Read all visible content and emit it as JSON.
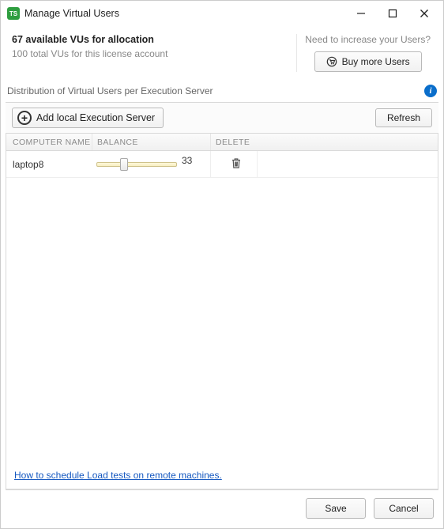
{
  "window": {
    "title": "Manage Virtual Users"
  },
  "summary": {
    "available_line": "67 available VUs for allocation",
    "total_line": "100 total VUs for this license account",
    "hint": "Need to increase your Users?",
    "buy_label": "Buy more Users"
  },
  "distribution": {
    "header": "Distribution of Virtual Users per Execution Server",
    "add_label": "Add local Execution Server",
    "refresh_label": "Refresh",
    "columns": {
      "name": "COMPUTER NAME",
      "balance": "BALANCE",
      "delete": "DELETE"
    },
    "rows": [
      {
        "name": "laptop8",
        "balance": 33,
        "thumb_pct": 33,
        "max": 100
      }
    ]
  },
  "help": {
    "link_text": "How to schedule Load tests on remote machines."
  },
  "footer": {
    "save": "Save",
    "cancel": "Cancel"
  }
}
